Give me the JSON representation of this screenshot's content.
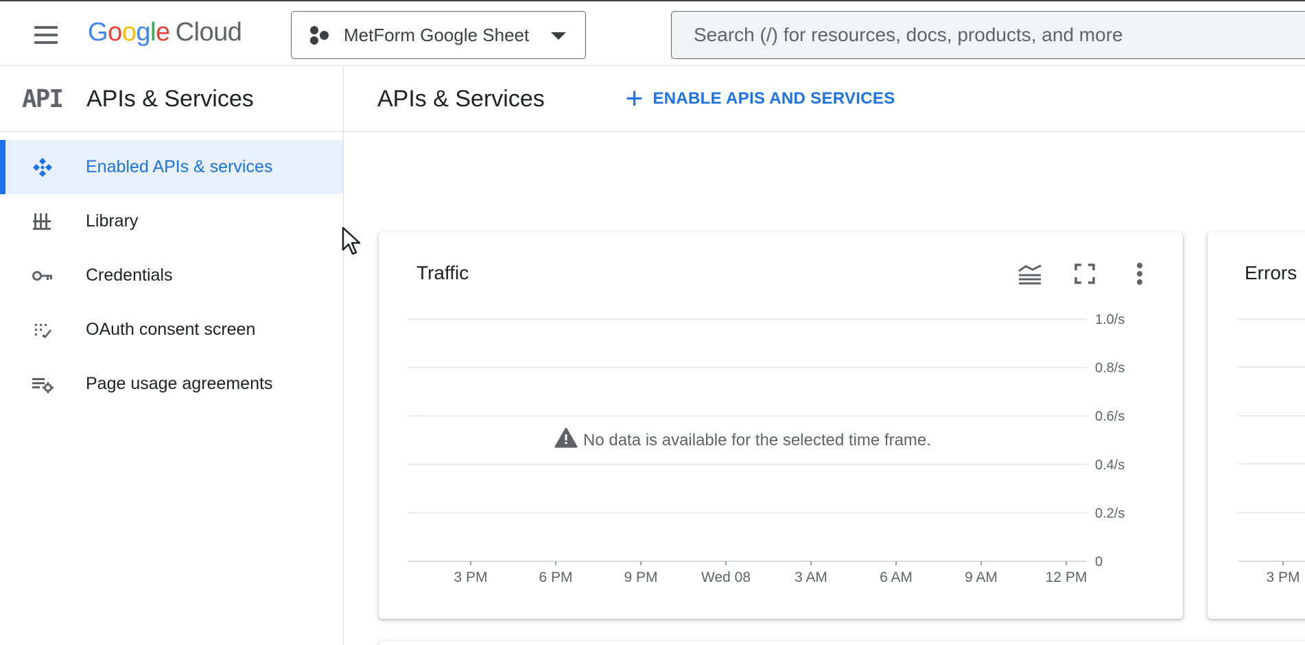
{
  "topbar": {
    "logo_google_letters": [
      "G",
      "o",
      "o",
      "g",
      "l",
      "e"
    ],
    "logo_cloud": "Cloud",
    "project_name": "MetForm Google Sheet",
    "search_placeholder": "Search (/) for resources, docs, products, and more"
  },
  "sidebar": {
    "logo_text": "API",
    "title": "APIs & Services",
    "items": [
      {
        "label": "Enabled APIs & services",
        "icon": "diamond-icon",
        "active": true
      },
      {
        "label": "Library",
        "icon": "library-icon",
        "active": false
      },
      {
        "label": "Credentials",
        "icon": "key-icon",
        "active": false
      },
      {
        "label": "OAuth consent screen",
        "icon": "oauth-icon",
        "active": false
      },
      {
        "label": "Page usage agreements",
        "icon": "settings-list-icon",
        "active": false
      }
    ]
  },
  "main": {
    "title": "APIs & Services",
    "enable_button": "ENABLE APIS AND SERVICES"
  },
  "cards": {
    "traffic_title": "Traffic",
    "errors_title": "Errors",
    "errors_partial_tick": "3 PM",
    "no_data_message": "No data is available for the selected time frame."
  },
  "colors": {
    "accent": "#1a73e8",
    "active_bg": "#e8f0fe",
    "icon_gray": "#5f6368",
    "grid": "#e0e0e0"
  },
  "chart_data": {
    "type": "line",
    "title": "Traffic",
    "series": [],
    "x_ticks": [
      "3 PM",
      "6 PM",
      "9 PM",
      "Wed 08",
      "3 AM",
      "6 AM",
      "9 AM",
      "12 PM"
    ],
    "y_ticks": [
      "0",
      "0.2/s",
      "0.4/s",
      "0.6/s",
      "0.8/s",
      "1.0/s"
    ],
    "ylim": [
      0,
      1.0
    ],
    "grid": true,
    "y_axis_side": "right"
  }
}
